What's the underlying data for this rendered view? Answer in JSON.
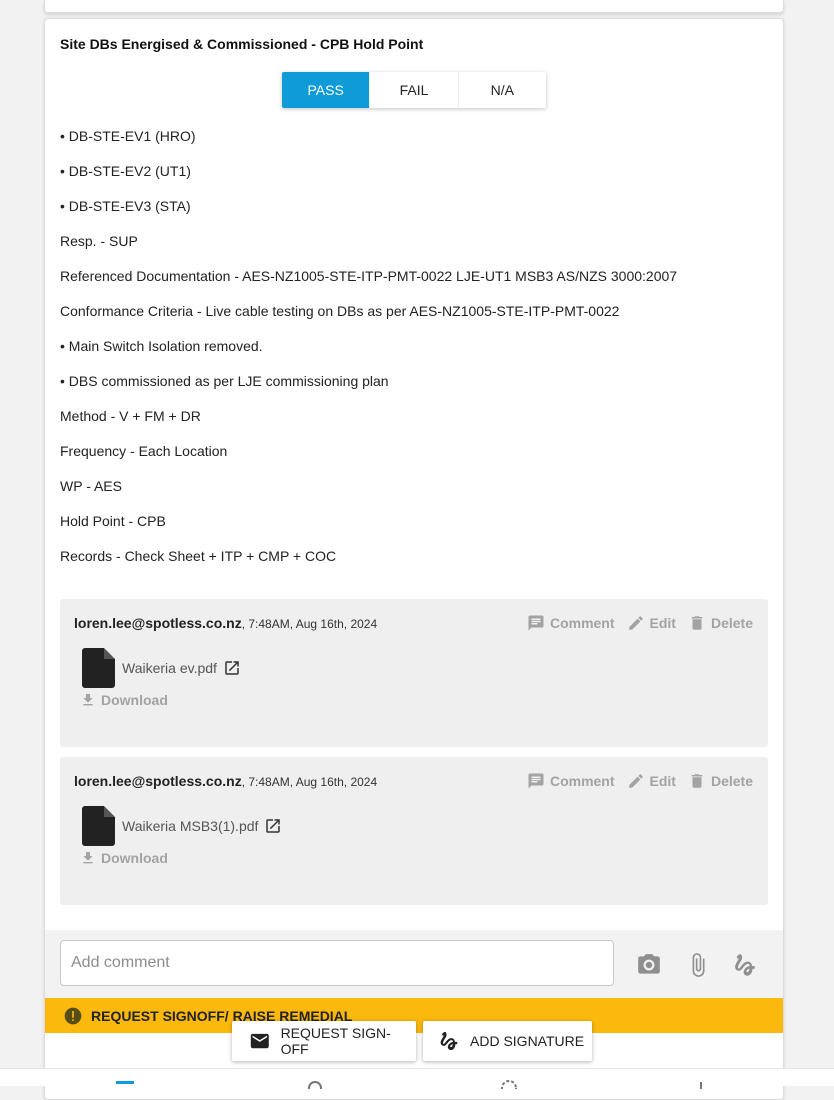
{
  "item": {
    "title": "Site DBs Energised & Commissioned - CPB Hold Point",
    "result_options": [
      "PASS",
      "FAIL",
      "N/A"
    ],
    "selected_result": "PASS",
    "lines": [
      "• DB-STE-EV1 (HRO)",
      "• DB-STE-EV2 (UT1)",
      "• DB-STE-EV3 (STA)",
      "Resp. - SUP",
      "Referenced Documentation - AES-NZ1005-STE-ITP-PMT-0022 LJE-UT1 MSB3 AS/NZS 3000:2007",
      "Conformance Criteria - Live cable testing on DBs as per AES-NZ1005-STE-ITP-PMT-0022",
      "• Main Switch Isolation removed.",
      "• DBS commissioned as per LJE commissioning plan",
      "Method - V + FM + DR",
      "Frequency - Each Location",
      "WP - AES",
      "Hold Point - CPB",
      "Records - Check Sheet + ITP + CMP + COC"
    ]
  },
  "comments": [
    {
      "author": "loren.lee@spotless.co.nz",
      "timestamp": ", 7:48AM, Aug 16th, 2024",
      "file_name": "Waikeria ev.pdf"
    },
    {
      "author": "loren.lee@spotless.co.nz",
      "timestamp": ", 7:48AM, Aug 16th, 2024",
      "file_name": "Waikeria MSB3(1).pdf"
    }
  ],
  "comment_actions": {
    "comment": "Comment",
    "edit": "Edit",
    "delete": "Delete",
    "download": "Download"
  },
  "comment_bar": {
    "placeholder": "Add comment",
    "icons": [
      "camera-icon",
      "paperclip-icon",
      "signature-icon"
    ]
  },
  "banner": {
    "text": "REQUEST SIGNOFF/ RAISE REMEDIAL",
    "color": "#fbb90d"
  },
  "footer": {
    "request_signoff": "REQUEST SIGN-OFF",
    "add_signature": "ADD SIGNATURE"
  },
  "colors": {
    "accent": "#0f9ad8",
    "muted": "#a3a3a3"
  }
}
